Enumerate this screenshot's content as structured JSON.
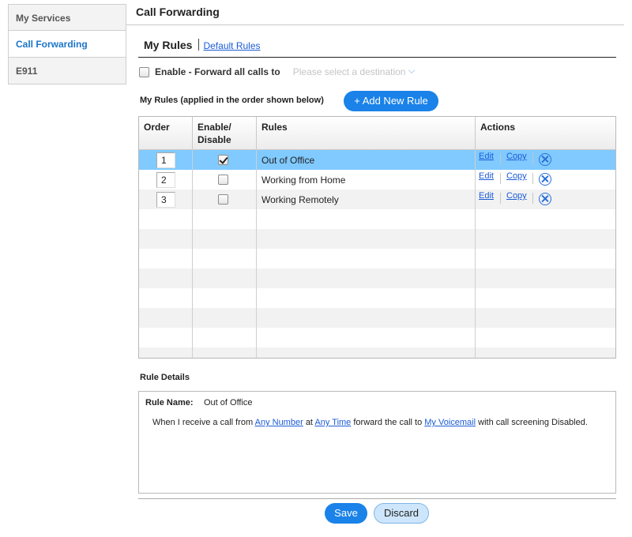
{
  "sidebar": {
    "items": [
      {
        "label": "My Services",
        "active": false
      },
      {
        "label": "Call Forwarding",
        "active": true
      },
      {
        "label": "E911",
        "active": false
      }
    ]
  },
  "header": {
    "title": "Call Forwarding"
  },
  "tabs": {
    "active": "My Rules",
    "other": "Default Rules"
  },
  "forward_all": {
    "label": "Enable - Forward all calls to",
    "checked": false,
    "destination_placeholder": "Please select a destination"
  },
  "rules_section": {
    "caption": "My Rules (applied in the order shown below)",
    "add_button": "+ Add New Rule"
  },
  "table": {
    "headers": {
      "order": "Order",
      "enable": "Enable/ Disable",
      "rules": "Rules",
      "actions": "Actions"
    },
    "rows": [
      {
        "order": "1",
        "enabled": true,
        "name": "Out of Office",
        "edit": "Edit",
        "copy": "Copy",
        "selected": true
      },
      {
        "order": "2",
        "enabled": false,
        "name": "Working from Home",
        "edit": "Edit",
        "copy": "Copy",
        "selected": false
      },
      {
        "order": "3",
        "enabled": false,
        "name": "Working Remotely",
        "edit": "Edit",
        "copy": "Copy",
        "selected": false
      }
    ]
  },
  "details": {
    "title": "Rule Details",
    "rule_name_label": "Rule Name:",
    "rule_name": "Out of Office",
    "text_1": "When I receive a call from",
    "link_1": "Any Number",
    "text_2": "at",
    "link_2": "Any Time",
    "text_3": "forward the call to",
    "link_3": "My Voicemail",
    "text_4": "with call screening Disabled."
  },
  "buttons": {
    "save": "Save",
    "discard": "Discard"
  },
  "colors": {
    "accent": "#1a82e8",
    "selected_row": "#80caff",
    "link": "#1b5bd6"
  }
}
